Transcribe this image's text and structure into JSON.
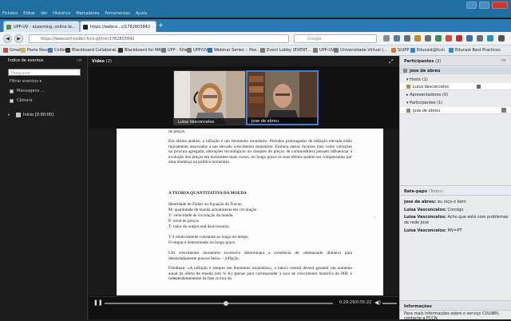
{
  "os": {
    "menu": [
      "Ficheiro",
      "Editar",
      "Ver",
      "Histórico",
      "Marcadores",
      "Ferramentas",
      "Ajuda"
    ]
  },
  "browser": {
    "tabs": [
      {
        "label": "UPP-UV - eLearning, online le...",
        "active": false
      },
      {
        "label": "https://webco...c/1782803842",
        "active": true
      }
    ],
    "url": "https://webconf-colibri.fccn.pt/nsr/1782803842",
    "search_placeholder": "Google",
    "bookmarks": [
      "Gmail",
      "Pasta Nova",
      "Colibri",
      "Blackboard Collaborat...",
      "Blackboard for MAC",
      "UPP - Site",
      "UPP/UV",
      "Webinar Series :: Pea...",
      "Event Lobby (EVENT...",
      "UPP-UV",
      "Universidade Virtual |...",
      "SIUPP",
      "Educast@fccn",
      "Educast Best Practices"
    ]
  },
  "left_panel": {
    "title": "Índice de eventos",
    "search_placeholder": "Pesquisar",
    "filter_label": "Filtrar eventos",
    "options": [
      "Mensagens ...",
      "Câmara"
    ],
    "index_item": "Início [0:00:00]"
  },
  "video": {
    "title": "Vídeo",
    "count": "(2)",
    "participants": [
      {
        "name": "Luisa Vasconcelos",
        "active": false
      },
      {
        "name": "jose de abreu",
        "active": true
      }
    ]
  },
  "document": {
    "lines": [
      "de preços.",
      "Em última análise, a inflação é um fenómeno monetário. Períodos prolongados de inflação elevada estão tipicamente associados a um elevado crescimento monetário. Embora outros factores (tais como variações na procura agregada, alterações tecnológicas ou choques de preços de commodities) possam influenciar a evolução dos preços em horizontes mais curtos, no longo prazo os seus efeitos podem ser compensados por uma mudança na política monetária.",
      "A TEORIA QUANTITATIVA DA MOEDA",
      "Identidade de Fisher ou Equação da Trocas:",
      "M: quantidade de moeda actualmente em circulação",
      "V: velocidade de circulação da moeda",
      "P: nível de preços",
      "T: valor do output real da economia",
      "V é relativamente constante ao longo do tempo",
      "O output é determinado no longo prazo",
      "Um crescimento monetário excessivo determinará a existência de «demasiado dinheiro para demasiadamente poucos bens» – inflação.",
      "Friedman: «A inflação é sempre um fenómeno monetário»; o banco central deverá garantir um aumento anual da oferta de moeda (em % K) apenas para corresponder à taxa de crescimento histórica do PIB; e independentemente da fase cíclica da"
    ]
  },
  "player": {
    "timecode": "0:29:29/0:55:22",
    "progress": 0.53
  },
  "participants_panel": {
    "title": "Participantes",
    "count": "(2)",
    "self": "jose de abreu",
    "hosts_label": "Hosts (1)",
    "host": "Luisa Vasconcelos",
    "presenters_label": "Apresentadores (0)",
    "participants_label": "Participantes (1)",
    "participant": "jose de abreu"
  },
  "chat": {
    "title": "Bate-papo",
    "scope": "(Todos)",
    "messages": [
      {
        "author": "jose de abreu:",
        "text": "eu oiço-o bem"
      },
      {
        "author": "Luisa Vasconcelos:",
        "text": "Consigo"
      },
      {
        "author": "Luisa Vasconcelos:",
        "text": "Acho que está com problemas de rede José"
      },
      {
        "author": "Luisa Vasconcelos:",
        "text": "MV=PT"
      }
    ]
  },
  "info": {
    "title": "Informações",
    "text": "Para mais informações sobre o serviço COLIBRI, contacte a FCCN."
  }
}
